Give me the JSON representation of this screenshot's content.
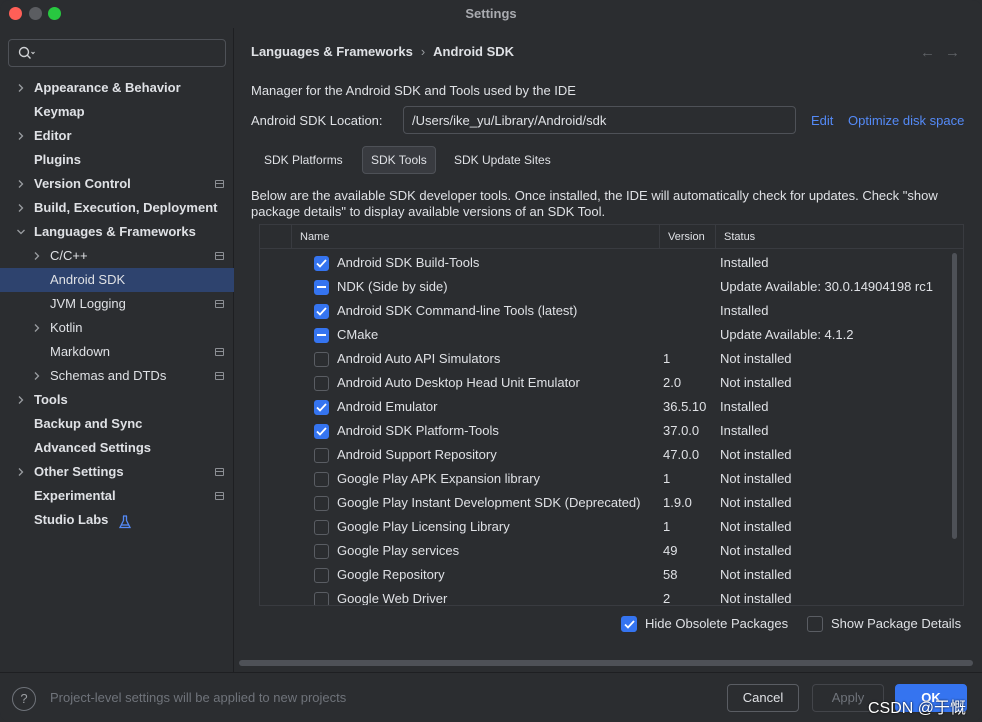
{
  "window": {
    "title": "Settings"
  },
  "sidebar": {
    "search_placeholder": "",
    "items": [
      {
        "label": "Appearance & Behavior",
        "bold": true,
        "expander": "collapsed",
        "level": 0,
        "project_icon": false
      },
      {
        "label": "Keymap",
        "bold": true,
        "expander": "none",
        "level": 0,
        "project_icon": false
      },
      {
        "label": "Editor",
        "bold": true,
        "expander": "collapsed",
        "level": 0,
        "project_icon": false
      },
      {
        "label": "Plugins",
        "bold": true,
        "expander": "none",
        "level": 0,
        "project_icon": false
      },
      {
        "label": "Version Control",
        "bold": true,
        "expander": "collapsed",
        "level": 0,
        "project_icon": true
      },
      {
        "label": "Build, Execution, Deployment",
        "bold": true,
        "expander": "collapsed",
        "level": 0,
        "project_icon": false
      },
      {
        "label": "Languages & Frameworks",
        "bold": true,
        "expander": "expanded",
        "level": 0,
        "project_icon": false
      },
      {
        "label": "C/C++",
        "bold": false,
        "expander": "collapsed",
        "level": 1,
        "project_icon": true
      },
      {
        "label": "Android SDK",
        "bold": false,
        "expander": "none",
        "level": 1,
        "project_icon": false,
        "selected": true
      },
      {
        "label": "JVM Logging",
        "bold": false,
        "expander": "none",
        "level": 1,
        "project_icon": true
      },
      {
        "label": "Kotlin",
        "bold": false,
        "expander": "collapsed",
        "level": 1,
        "project_icon": false
      },
      {
        "label": "Markdown",
        "bold": false,
        "expander": "none",
        "level": 1,
        "project_icon": true
      },
      {
        "label": "Schemas and DTDs",
        "bold": false,
        "expander": "collapsed",
        "level": 1,
        "project_icon": true
      },
      {
        "label": "Tools",
        "bold": true,
        "expander": "collapsed",
        "level": 0,
        "project_icon": false
      },
      {
        "label": "Backup and Sync",
        "bold": true,
        "expander": "none",
        "level": 0,
        "project_icon": false
      },
      {
        "label": "Advanced Settings",
        "bold": true,
        "expander": "none",
        "level": 0,
        "project_icon": false
      },
      {
        "label": "Other Settings",
        "bold": true,
        "expander": "collapsed",
        "level": 0,
        "project_icon": true
      },
      {
        "label": "Experimental",
        "bold": true,
        "expander": "none",
        "level": 0,
        "project_icon": true
      },
      {
        "label": "Studio Labs",
        "bold": true,
        "expander": "none",
        "level": 0,
        "project_icon": false,
        "icon": "flask-icon"
      }
    ]
  },
  "main": {
    "breadcrumb": {
      "parent": "Languages & Frameworks",
      "separator": "›",
      "current": "Android SDK"
    },
    "description": "Manager for the Android SDK and Tools used by the IDE",
    "location": {
      "label": "Android SDK Location:",
      "value": "/Users/ike_yu/Library/Android/sdk",
      "edit_label": "Edit",
      "optimize_label": "Optimize disk space"
    },
    "tabs": [
      {
        "label": "SDK Platforms",
        "active": false
      },
      {
        "label": "SDK Tools",
        "active": true
      },
      {
        "label": "SDK Update Sites",
        "active": false
      }
    ],
    "info_text": "Below are the available SDK developer tools. Once installed, the IDE will automatically check for updates. Check \"show package details\" to display available versions of an SDK Tool.",
    "table": {
      "columns": {
        "name": "Name",
        "version": "Version",
        "status": "Status"
      },
      "rows": [
        {
          "state": "checked",
          "name": "Android SDK Build-Tools",
          "version": "",
          "status": "Installed"
        },
        {
          "state": "partial",
          "name": "NDK (Side by side)",
          "version": "",
          "status": "Update Available: 30.0.14904198 rc1"
        },
        {
          "state": "checked",
          "name": "Android SDK Command-line Tools (latest)",
          "version": "",
          "status": "Installed"
        },
        {
          "state": "partial",
          "name": "CMake",
          "version": "",
          "status": "Update Available: 4.1.2"
        },
        {
          "state": "unchecked",
          "name": "Android Auto API Simulators",
          "version": "1",
          "status": "Not installed"
        },
        {
          "state": "unchecked",
          "name": "Android Auto Desktop Head Unit Emulator",
          "version": "2.0",
          "status": "Not installed"
        },
        {
          "state": "checked",
          "name": "Android Emulator",
          "version": "36.5.10",
          "status": "Installed"
        },
        {
          "state": "checked",
          "name": "Android SDK Platform-Tools",
          "version": "37.0.0",
          "status": "Installed"
        },
        {
          "state": "unchecked",
          "name": "Android Support Repository",
          "version": "47.0.0",
          "status": "Not installed"
        },
        {
          "state": "unchecked",
          "name": "Google Play APK Expansion library",
          "version": "1",
          "status": "Not installed"
        },
        {
          "state": "unchecked",
          "name": "Google Play Instant Development SDK (Deprecated)",
          "version": "1.9.0",
          "status": "Not installed"
        },
        {
          "state": "unchecked",
          "name": "Google Play Licensing Library",
          "version": "1",
          "status": "Not installed"
        },
        {
          "state": "unchecked",
          "name": "Google Play services",
          "version": "49",
          "status": "Not installed"
        },
        {
          "state": "unchecked",
          "name": "Google Repository",
          "version": "58",
          "status": "Not installed"
        },
        {
          "state": "unchecked",
          "name": "Google Web Driver",
          "version": "2",
          "status": "Not installed"
        }
      ]
    },
    "options": {
      "hide_obsolete": {
        "label": "Hide Obsolete Packages",
        "checked": true
      },
      "show_details": {
        "label": "Show Package Details",
        "checked": false
      }
    }
  },
  "footer": {
    "help_label": "?",
    "note": "Project-level settings will be applied to new projects",
    "cancel_label": "Cancel",
    "apply_label": "Apply",
    "ok_label": "OK",
    "watermark": "CSDN @于慨"
  },
  "colors": {
    "accent": "#3574f0",
    "link": "#548af7",
    "selection": "#2e436e",
    "background": "#2b2d30"
  }
}
